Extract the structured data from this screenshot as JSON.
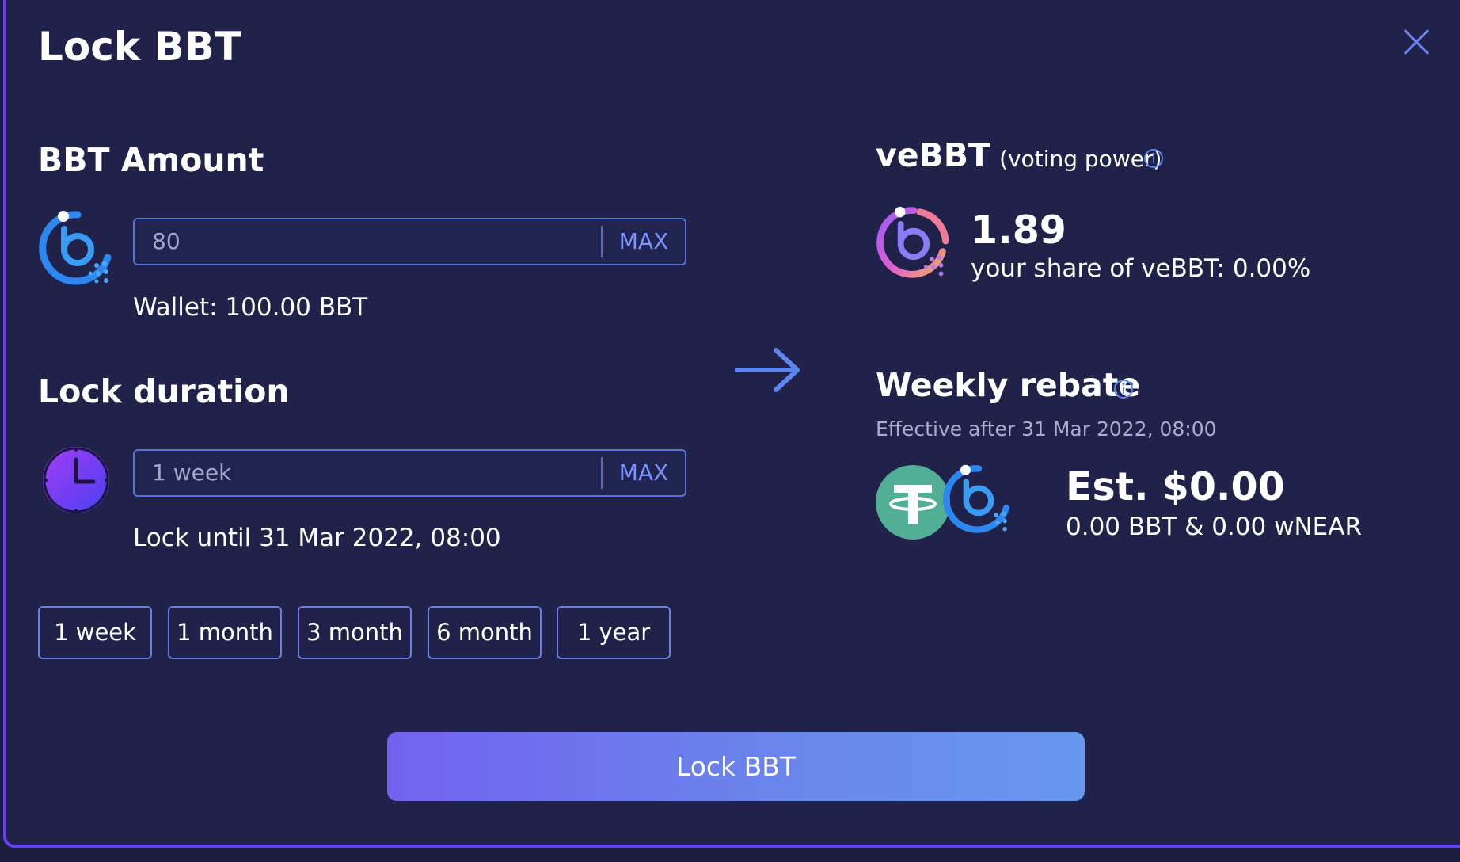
{
  "modal": {
    "title": "Lock BBT",
    "close_icon": "close-icon"
  },
  "amount": {
    "heading": "BBT Amount",
    "input_value": "80",
    "max_label": "MAX",
    "wallet_text": "Wallet: 100.00 BBT",
    "token_icon": "bbt-logo-icon"
  },
  "duration": {
    "heading": "Lock duration",
    "input_value": "1 week",
    "max_label": "MAX",
    "lock_until_text": "Lock until 31 Mar 2022, 08:00",
    "clock_icon": "clock-icon",
    "presets": [
      "1 week",
      "1 month",
      "3 month",
      "6 month",
      "1 year"
    ]
  },
  "arrow_icon": "arrow-right-icon",
  "vebbt": {
    "heading": "veBBT",
    "subheading": "(voting power)",
    "value": "1.89",
    "share_text": "your share of veBBT: 0.00%",
    "info_icon": "info-icon",
    "token_icon": "vebbt-logo-icon"
  },
  "rebate": {
    "heading": "Weekly rebate",
    "effective_text": "Effective after 31 Mar 2022, 08:00",
    "estimate": "Est. $0.00",
    "breakdown": "0.00 BBT & 0.00 wNEAR",
    "info_icon": "info-icon",
    "token_icons": [
      "tether-icon",
      "bbt-logo-icon"
    ]
  },
  "primary_button": {
    "label": "Lock BBT"
  },
  "colors": {
    "background": "#20224a",
    "border_accent": "#6a3ff0",
    "input_border": "#5a73d9",
    "max_text": "#7a93ff",
    "button_gradient_start": "#7263ee",
    "button_gradient_end": "#6797ee",
    "tether_green": "#50af95"
  }
}
